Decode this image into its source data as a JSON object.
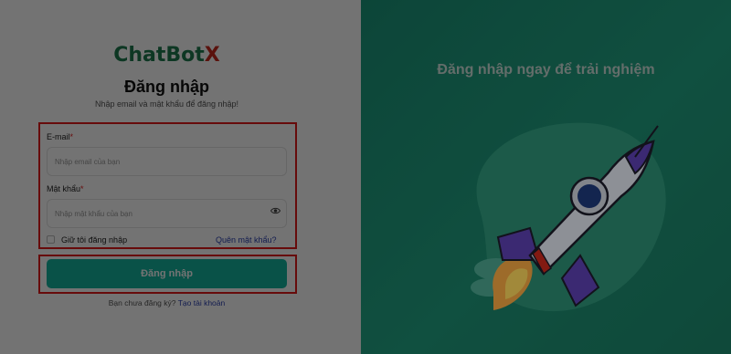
{
  "brand": {
    "name": "ChatBot",
    "suffix": "X"
  },
  "login": {
    "title": "Đăng nhập",
    "subtitle": "Nhập email và mật khẩu để đăng nhập!",
    "email": {
      "label": "E-mail",
      "required_mark": "*",
      "placeholder": "Nhập email của bạn",
      "value": ""
    },
    "password": {
      "label": "Mật khẩu",
      "required_mark": "*",
      "placeholder": "Nhập mật khẩu của bạn",
      "value": ""
    },
    "remember_label": "Giữ tôi đăng nhập",
    "forgot_label": "Quên mật khẩu?",
    "submit_label": "Đăng nhập",
    "signup_prompt": "Bạn chưa đăng ký?",
    "signup_link": "Tạo tài khoản"
  },
  "promo": {
    "tagline": "Đăng nhập ngay để trải nghiệm"
  },
  "colors": {
    "brand_green": "#1e7a4f",
    "brand_red": "#c8291d",
    "primary_button": "#14b5a0",
    "link": "#2a3fb0",
    "panel_green": "#177059",
    "highlight_border": "#e51a1a"
  },
  "icons": {
    "password_toggle": "eye-icon",
    "illustration": "rocket-illustration"
  }
}
